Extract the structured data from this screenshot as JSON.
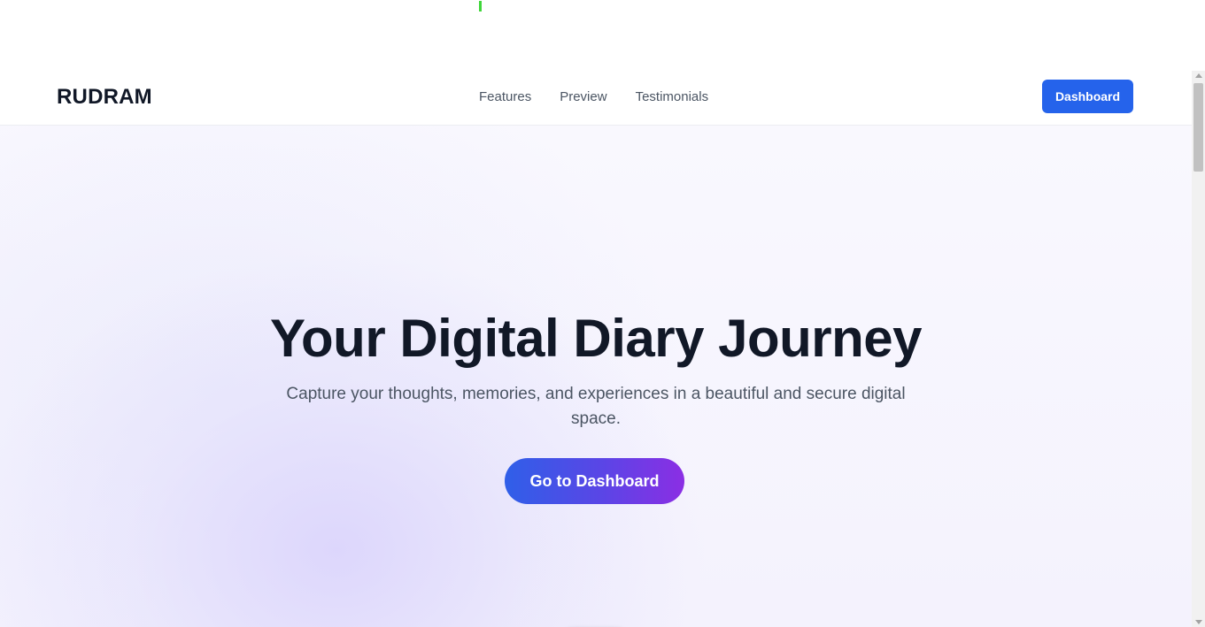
{
  "navbar": {
    "brand": "RUDRAM",
    "links": [
      "Features",
      "Preview",
      "Testimonials"
    ],
    "dashboard_label": "Dashboard"
  },
  "hero": {
    "title": "Your Digital Diary Journey",
    "subtitle": "Capture your thoughts, memories, and experiences in a beautiful and secure digital space.",
    "cta_label": "Go to Dashboard"
  },
  "toolbar": {
    "icons": [
      "comment-icon",
      "add-user-icon",
      "menu-list-icon"
    ]
  },
  "colors": {
    "primary": "#2563eb",
    "gradient_start": "#2f5fe8",
    "gradient_end": "#8b2ee4",
    "heading": "#111827",
    "body_text": "#4b5563"
  }
}
